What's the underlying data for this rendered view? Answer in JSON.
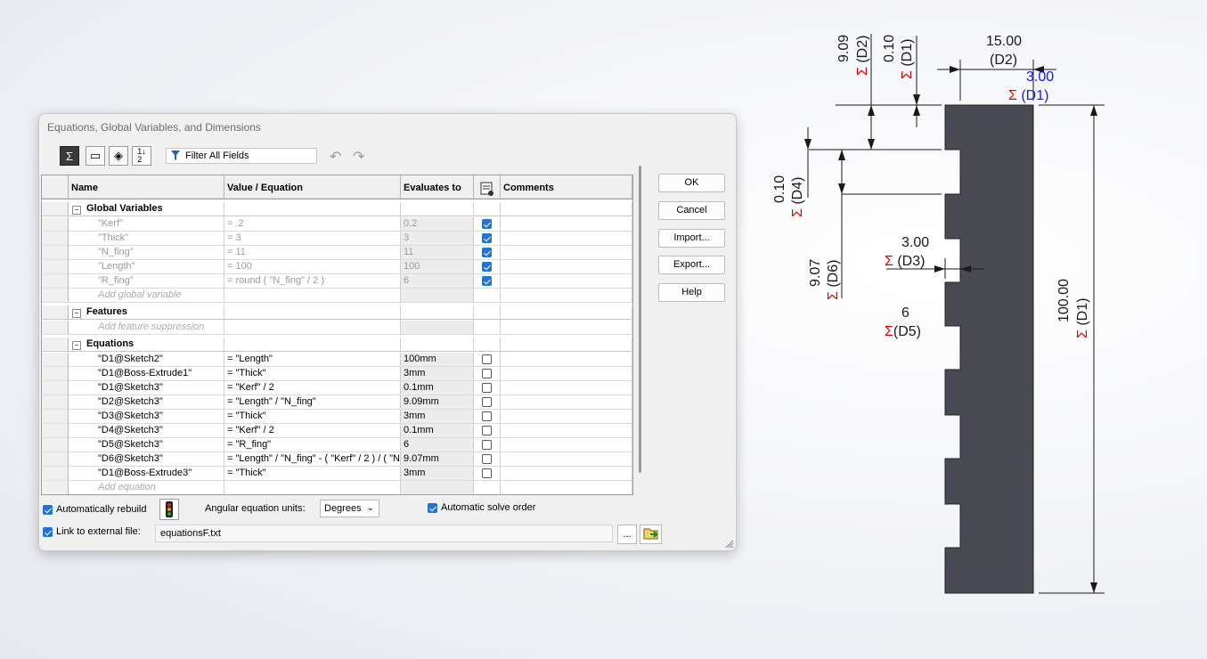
{
  "dialog": {
    "title": "Equations, Global Variables, and Dimensions",
    "filter_placeholder": "Filter All Fields",
    "toolbar_icons": [
      "equation-view-icon",
      "sketch-equation-view-icon",
      "dimension-view-icon",
      "ordered-view-icon"
    ],
    "columns": [
      "Name",
      "Value / Equation",
      "Evaluates to",
      "",
      "Comments"
    ],
    "sections": {
      "global": "Global Variables",
      "features": "Features",
      "equations": "Equations"
    },
    "global_vars": [
      {
        "name": "\"Kerf\"",
        "value": "= .2",
        "eval": "0.2",
        "checked": true
      },
      {
        "name": "\"Thick\"",
        "value": "= 3",
        "eval": "3",
        "checked": true
      },
      {
        "name": "\"N_fing\"",
        "value": "= 11",
        "eval": "11",
        "checked": true
      },
      {
        "name": "\"Length\"",
        "value": "= 100",
        "eval": "100",
        "checked": true
      },
      {
        "name": "\"R_fing\"",
        "value": "= round ( \"N_fing\" / 2 )",
        "eval": "6",
        "checked": true
      }
    ],
    "add_global": "Add global variable",
    "add_feature": "Add feature suppression",
    "equations": [
      {
        "name": "\"D1@Sketch2\"",
        "value": "= \"Length\"",
        "eval": "100mm"
      },
      {
        "name": "\"D1@Boss-Extrude1\"",
        "value": "= \"Thick\"",
        "eval": "3mm"
      },
      {
        "name": "\"D1@Sketch3\"",
        "value": "= \"Kerf\" / 2",
        "eval": "0.1mm"
      },
      {
        "name": "\"D2@Sketch3\"",
        "value": "= \"Length\" / \"N_fing\"",
        "eval": "9.09mm"
      },
      {
        "name": "\"D3@Sketch3\"",
        "value": "= \"Thick\"",
        "eval": "3mm"
      },
      {
        "name": "\"D4@Sketch3\"",
        "value": "= \"Kerf\" / 2",
        "eval": "0.1mm"
      },
      {
        "name": "\"D5@Sketch3\"",
        "value": "= \"R_fing\"",
        "eval": "6"
      },
      {
        "name": "\"D6@Sketch3\"",
        "value": "= \"Length\" / \"N_fing\" - ( \"Kerf\" / 2 ) / ( \"N",
        "eval": "9.07mm"
      },
      {
        "name": "\"D1@Boss-Extrude3\"",
        "value": "= \"Thick\"",
        "eval": "3mm"
      }
    ],
    "add_equation": "Add equation",
    "buttons": {
      "ok": "OK",
      "cancel": "Cancel",
      "import": "Import...",
      "export": "Export...",
      "help": "Help"
    },
    "auto_rebuild": "Automatically rebuild",
    "angular_units_label": "Angular equation units:",
    "angular_units_value": "Degrees",
    "auto_solve": "Automatic solve order",
    "link_external": "Link to external file:",
    "external_file": "equationsF.txt",
    "browse": "..."
  },
  "drawing": {
    "sigma": "Σ",
    "d2_top_value": "9.09",
    "d2_top_label": "(D2)",
    "d1_top_value": "0.10",
    "d1_top_label": "(D1)",
    "w15_value": "15.00",
    "w15_label": "(D2)",
    "w3_value": "3.00",
    "w3_label": "(D1)",
    "d4_value": "0.10",
    "d4_label": "(D4)",
    "d6_value": "9.07",
    "d6_label": "(D6)",
    "d3_value": "3.00",
    "d3_label": "(D3)",
    "d5_value": "6",
    "d5_label": "(D5)",
    "len_value": "100.00",
    "len_label": "(D1)",
    "colors": {
      "part": "#4a4b52",
      "dim_line": "#1a1a1a",
      "sigma": "#e00000",
      "selected": "#1515ff"
    }
  }
}
